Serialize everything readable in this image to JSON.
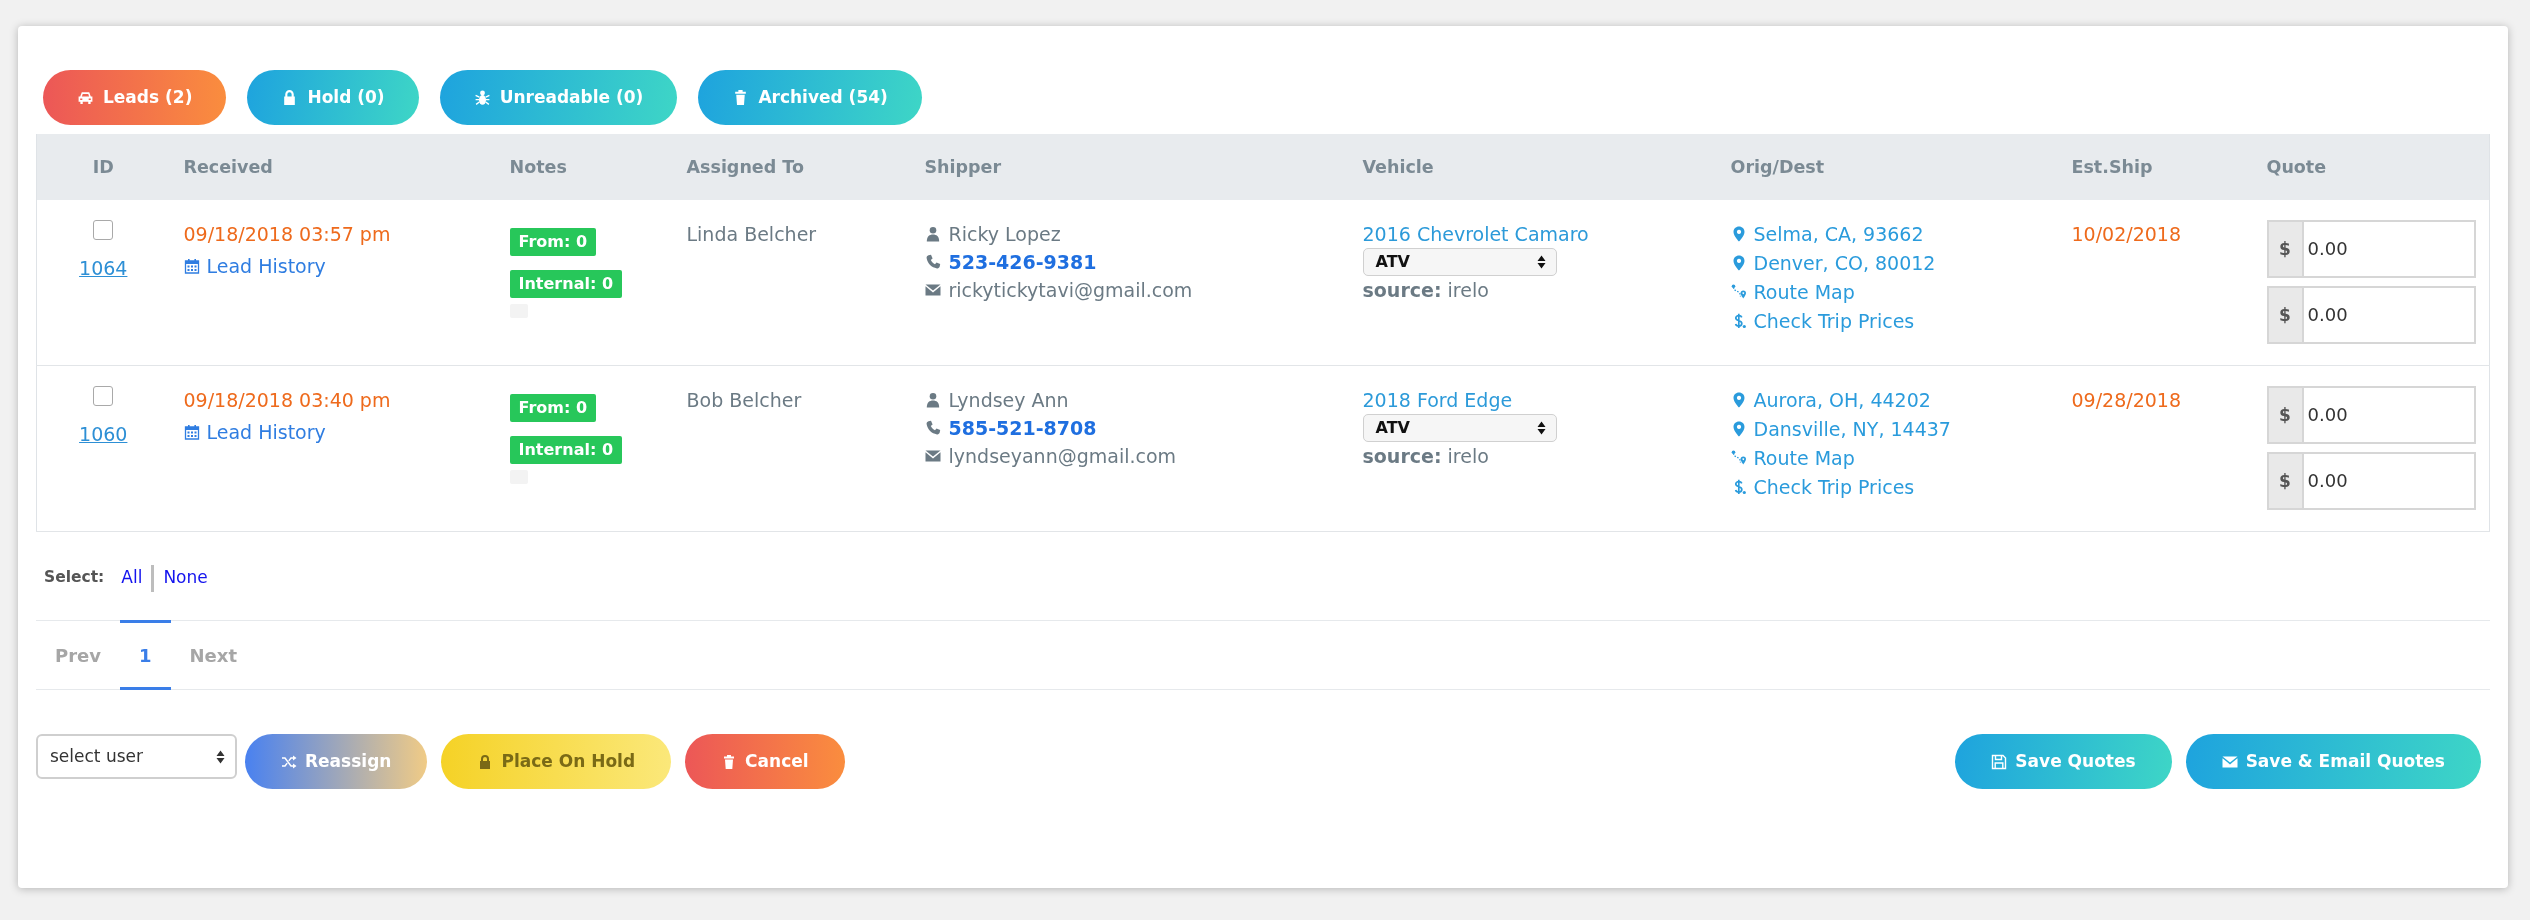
{
  "tabs": [
    {
      "label": "Leads (2)",
      "selected": true
    },
    {
      "label": "Hold (0)",
      "selected": false
    },
    {
      "label": "Unreadable (0)",
      "selected": false
    },
    {
      "label": "Archived (54)",
      "selected": false
    }
  ],
  "table": {
    "columns": [
      "ID",
      "Received",
      "Notes",
      "Assigned To",
      "Shipper",
      "Vehicle",
      "Orig/Dest",
      "Est.Ship",
      "Quote"
    ],
    "rows": [
      {
        "checked": false,
        "id": "1064",
        "received": "09/18/2018 03:57 pm",
        "history": "Lead History",
        "notes": [
          "From: 0",
          "Internal: 0"
        ],
        "assigned_to": "Linda Belcher",
        "shipper": {
          "name": "Ricky Lopez",
          "phone": "523-426-9381",
          "email": "rickytickytavi@gmail.com"
        },
        "vehicle": {
          "name": "2016 Chevrolet Camaro",
          "type": "ATV",
          "source": "**source:** irelo"
        },
        "route": {
          "origin": "Selma, CA, 93662",
          "destination": "Denver, CO, 80012",
          "map_link": "Route Map",
          "prices_link": "Check Trip Prices"
        },
        "est_ship": "10/02/2018",
        "quotes": [
          {
            "currency": "$",
            "value": "0.00"
          },
          {
            "currency": "$",
            "value": "0.00"
          }
        ]
      },
      {
        "checked": false,
        "id": "1060",
        "received": "09/18/2018 03:40 pm",
        "history": "Lead History",
        "notes": [
          "From: 0",
          "Internal: 0"
        ],
        "assigned_to": "Bob Belcher",
        "shipper": {
          "name": "Lyndsey Ann",
          "phone": "585-521-8708",
          "email": "lyndseyann@gmail.com"
        },
        "vehicle": {
          "name": "2018 Ford Edge",
          "type": "ATV",
          "source": "**source:** irelo"
        },
        "route": {
          "origin": "Aurora, OH, 44202",
          "destination": "Dansville, NY, 14437",
          "map_link": "Route Map",
          "prices_link": "Check Trip Prices"
        },
        "est_ship": "09/28/2018",
        "quotes": [
          {
            "currency": "$",
            "value": "0.00"
          },
          {
            "currency": "$",
            "value": "0.00"
          }
        ]
      }
    ]
  },
  "select": {
    "label": "Select:",
    "links": [
      "All",
      "None"
    ]
  },
  "pagination": [
    {
      "label": "Prev",
      "selected": false,
      "disabled": true
    },
    {
      "label": "1",
      "selected": true,
      "disabled": false
    },
    {
      "label": "Next",
      "selected": false,
      "disabled": true
    }
  ],
  "footer": {
    "user_select": "select user",
    "left_buttons": [
      {
        "label": "Reassign",
        "kind": "blend"
      },
      {
        "label": "Place On Hold",
        "kind": "warning"
      },
      {
        "label": "Cancel",
        "kind": "danger"
      }
    ],
    "right_buttons": [
      {
        "label": "Save Quotes",
        "kind": "info"
      },
      {
        "label": "Save & Email Quotes",
        "kind": "info"
      }
    ]
  }
}
